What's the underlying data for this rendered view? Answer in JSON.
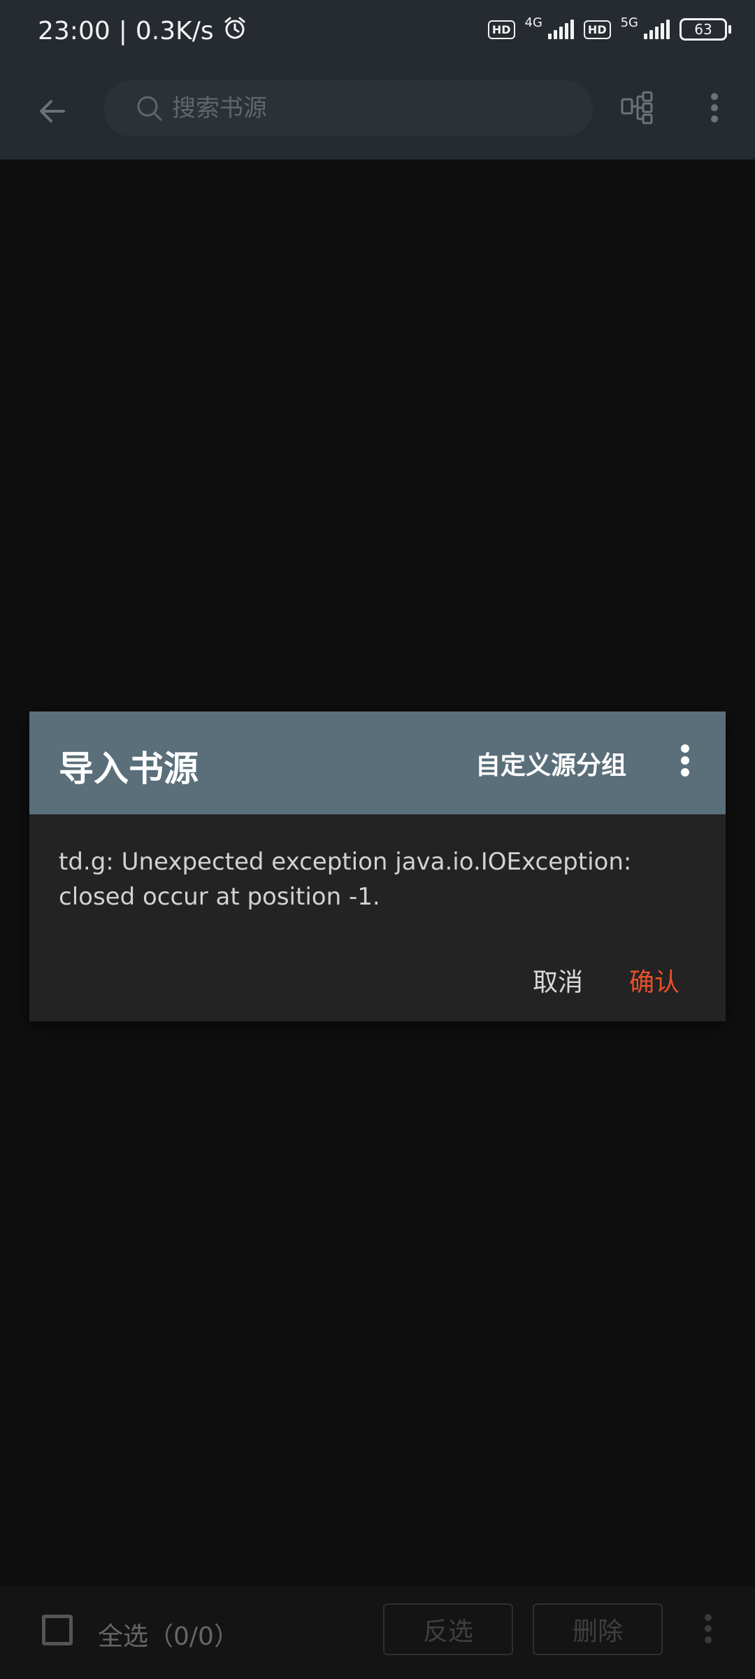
{
  "status_bar": {
    "time": "23:00",
    "separator": "|",
    "net_speed": "0.3K/s",
    "alarm_icon": "alarm-clock-icon",
    "sim1_badge": "HD",
    "sim1_network": "4G",
    "sim2_badge": "HD",
    "sim2_network": "5G",
    "battery": "63"
  },
  "toolbar": {
    "back_icon": "arrow-left-icon",
    "search_icon": "search-icon",
    "search_placeholder": "搜索书源",
    "group_icon": "group-icon",
    "more_icon": "more-vertical-icon"
  },
  "dialog": {
    "title": "导入书源",
    "action": "自定义源分组",
    "more_icon": "more-vertical-icon",
    "message": "td.g: Unexpected exception java.io.IOException: closed occur at position -1.",
    "cancel": "取消",
    "confirm": "确认"
  },
  "bottom_bar": {
    "select_all": "全选（0/0）",
    "invert": "反选",
    "delete": "删除",
    "more_icon": "more-vertical-icon"
  },
  "colors": {
    "appbar": "#252b31",
    "dialog_header": "#5a6f7a",
    "dialog_body": "#232323",
    "accent": "#e8502a",
    "background": "#0f0f0f"
  }
}
